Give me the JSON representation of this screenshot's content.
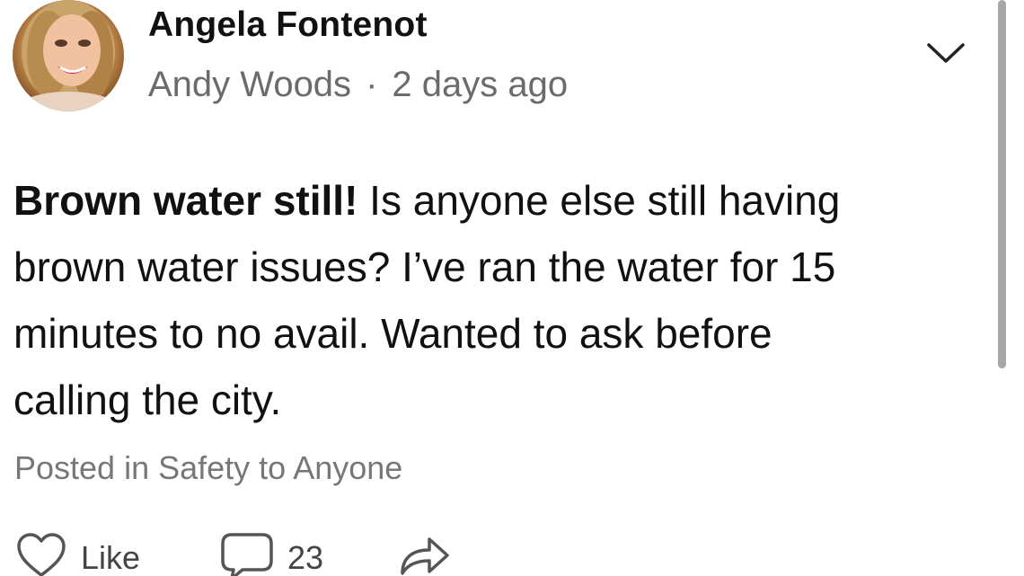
{
  "post": {
    "author_name": "Angela Fontenot",
    "sub_author": "Andy Woods",
    "separator": "·",
    "time_ago": "2 days ago",
    "headline": "Brown water still!",
    "body_line1": " Is anyone else still having",
    "body_line2": "brown water issues? I’ve ran the water for 15",
    "body_line3": "minutes to no avail.  Wanted to ask before",
    "body_line4": "calling the city.",
    "posted_in": "Posted in Safety to Anyone"
  },
  "actions": {
    "like_label": "Like",
    "comment_count": "23"
  },
  "icons": {
    "more": "chevron-down-icon",
    "like": "heart-icon",
    "comment": "comment-icon",
    "share": "share-arrow-icon"
  },
  "colors": {
    "text": "#111111",
    "secondary_text": "#6b6b6b",
    "scrollbar": "#a7a7a7"
  }
}
